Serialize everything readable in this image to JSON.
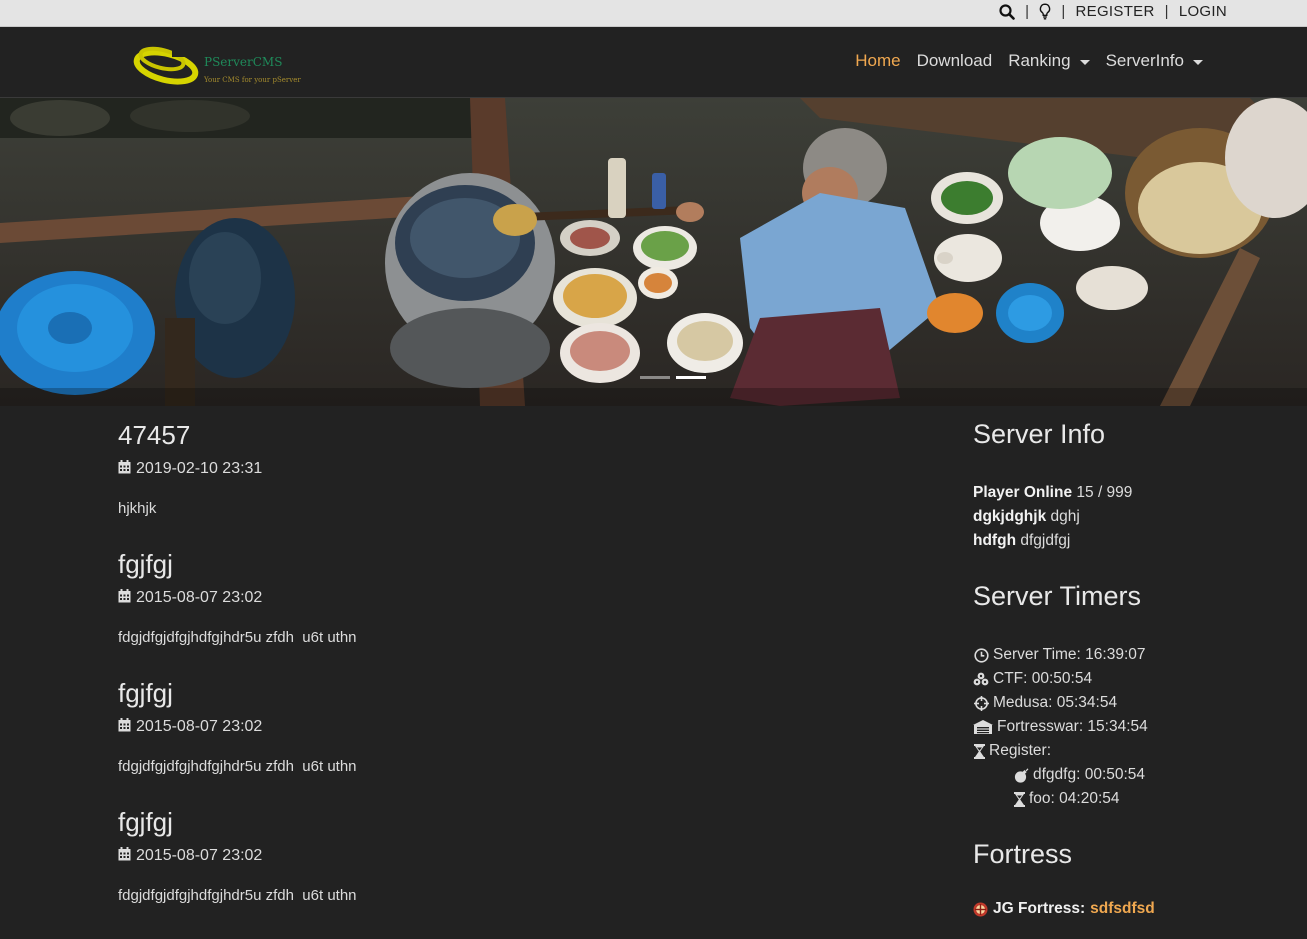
{
  "topbar": {
    "search_icon": "search-icon",
    "theme_icon": "lightbulb-icon",
    "separator": "|",
    "register": "REGISTER",
    "login": "LOGIN"
  },
  "brand": {
    "name": "PServerCMS",
    "tagline": "Your CMS for your pServer",
    "colors": {
      "ring": "#d6d400",
      "name": "#1f8a5a"
    }
  },
  "nav": {
    "home": "Home",
    "download": "Download",
    "ranking": "Ranking",
    "serverinfo": "ServerInfo",
    "active_color": "#f0a850"
  },
  "carousel": {
    "slides": 2,
    "active_slide": 2
  },
  "news": [
    {
      "title": "47457",
      "date": "2019-02-10 23:31",
      "body": "hjkhjk"
    },
    {
      "title": "fgjfgj",
      "date": "2015-08-07 23:02",
      "body": "fdgjdfgjdfgjhdfgjhdr5u zfdh  u6t uthn"
    },
    {
      "title": "fgjfgj",
      "date": "2015-08-07 23:02",
      "body": "fdgjdfgjdfgjhdfgjhdr5u zfdh  u6t uthn"
    },
    {
      "title": "fgjfgj",
      "date": "2015-08-07 23:02",
      "body": "fdgjdfgjdfgjhdfgjhdr5u zfdh  u6t uthn"
    }
  ],
  "server_info": {
    "heading": "Server Info",
    "rows": [
      {
        "label": "Player Online",
        "value": "15 / 999"
      },
      {
        "label": "dgkjdghjk",
        "value": "dghj"
      },
      {
        "label": "hdfgh",
        "value": "dfgjdfgj"
      }
    ]
  },
  "server_timers": {
    "heading": "Server Timers",
    "items": [
      {
        "icon": "clock-icon",
        "text": "Server Time: 16:39:07"
      },
      {
        "icon": "ctf-icon",
        "text": "CTF: 00:50:54"
      },
      {
        "icon": "crosshair-icon",
        "text": "Medusa: 05:34:54"
      },
      {
        "icon": "fortress-icon",
        "text": "Fortresswar: 15:34:54"
      },
      {
        "icon": "hourglass-icon",
        "text": "Register:"
      }
    ],
    "sub_items": [
      {
        "icon": "bomb-icon",
        "text": "dfgdfg: 00:50:54"
      },
      {
        "icon": "hourglass-icon",
        "text": "foo: 04:20:54"
      }
    ]
  },
  "fortress": {
    "heading": "Fortress",
    "label": "JG Fortress:",
    "owner": "sdfsdfsd",
    "owner_color": "#f0a850"
  }
}
